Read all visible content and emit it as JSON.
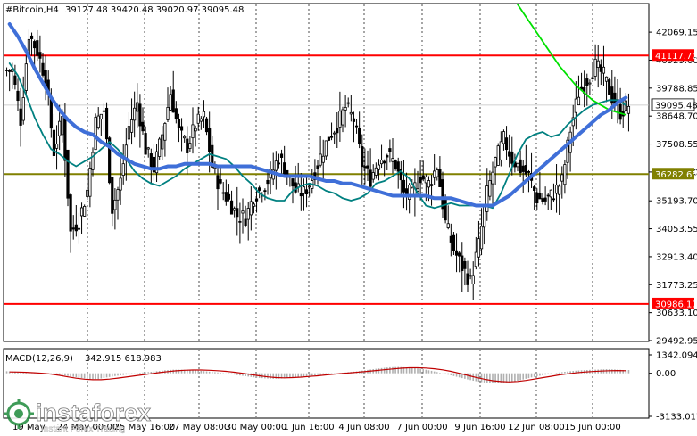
{
  "header": {
    "symbol_text": "#Bitcoin,H4",
    "ohlc_text": "39127.48 39420.48 39020.97 39095.48"
  },
  "macd_header": {
    "label": "MACD(12,26,9)",
    "values": "342.915 618.983"
  },
  "watermark": {
    "brand": "instaforex",
    "tagline": "Instant Forex Trading"
  },
  "colors": {
    "bull_candle": "#000000",
    "bear_candle": "#000000",
    "ma_fast": "#008080",
    "ma_mid": "#00e000",
    "ma_slow": "#3f6fd8",
    "resistance_line": "#ff0000",
    "support_line": "#ff0000",
    "pivot_line": "#808000",
    "macd_signal": "#c00000",
    "macd_hist": "#b0b0b0"
  },
  "chart_data": [
    {
      "type": "candlestick",
      "title": "#Bitcoin,H4",
      "timeframe": "H4",
      "last_ohlc": {
        "open": 39127.48,
        "high": 39420.48,
        "low": 39020.97,
        "close": 39095.48
      },
      "ylim": [
        29492.95,
        43200
      ],
      "y_ticks": [
        "42069.15",
        "40929.00",
        "39788.85",
        "38648.70",
        "37508.55",
        "36368.40",
        "35193.70",
        "34053.55",
        "32913.40",
        "31773.25",
        "30633.10",
        "29492.95"
      ],
      "x_ticks": [
        "19 May",
        "24 May 00:00",
        "25 May 16:00",
        "27 May 08:00",
        "30 May 00:00",
        "1 Jun 16:00",
        "4 Jun 08:00",
        "7 Jun 00:00",
        "9 Jun 16:00",
        "12 Jun 08:00",
        "15 Jun 00:00"
      ],
      "horizontal_levels": [
        {
          "label": "41117.70",
          "value": 41117.7,
          "color": "#ff0000"
        },
        {
          "label": "36282.65",
          "value": 36282.65,
          "color": "#808000"
        },
        {
          "label": "30986.17",
          "value": 30986.17,
          "color": "#ff0000"
        }
      ],
      "current_price_label": "39095.48",
      "close_series": [
        40500,
        38500,
        42000,
        41300,
        40200,
        37200,
        38600,
        33900,
        34400,
        35600,
        38400,
        38900,
        34900,
        36000,
        38200,
        39200,
        37300,
        36500,
        37900,
        39600,
        38000,
        37400,
        38300,
        38600,
        36600,
        35700,
        35200,
        34600,
        34500,
        35400,
        35700,
        36200,
        37000,
        36300,
        35600,
        35500,
        36100,
        37000,
        37800,
        38300,
        39000,
        38500,
        36700,
        36100,
        36900,
        37100,
        36700,
        35500,
        35500,
        36200,
        35900,
        36600,
        34300,
        33200,
        32500,
        31900,
        33400,
        35500,
        36800,
        37700,
        36900,
        36500,
        36200,
        35300,
        35200,
        35500,
        36000,
        38100,
        39600,
        40100,
        40700,
        40300,
        39400,
        38800,
        39100
      ],
      "series": [
        {
          "name": "",
          "color": "#008080",
          "values": [
            40800,
            40300,
            39500,
            38600,
            37900,
            37300,
            37100,
            36800,
            36600,
            36800,
            37000,
            37300,
            37600,
            37300,
            36900,
            36400,
            36100,
            35900,
            35800,
            36000,
            36200,
            36500,
            36700,
            36900,
            37100,
            37000,
            36900,
            36600,
            36200,
            35900,
            35500,
            35300,
            35200,
            35200,
            35600,
            35800,
            35900,
            35800,
            35600,
            35500,
            35300,
            35200,
            35300,
            35500,
            35900,
            36000,
            36200,
            36400,
            36100,
            35500,
            35000,
            34900,
            35000,
            35100,
            35000,
            35000,
            35000,
            35000,
            34900,
            35500,
            36300,
            37100,
            37700,
            37900,
            38000,
            37800,
            37900,
            38300,
            38600,
            38900,
            39100,
            39200,
            39300,
            39300,
            39100
          ]
        },
        {
          "name": "",
          "color": "#00e000",
          "values": [
            null,
            null,
            null,
            null,
            null,
            null,
            null,
            null,
            null,
            null,
            null,
            null,
            null,
            null,
            null,
            null,
            null,
            null,
            null,
            null,
            null,
            null,
            null,
            null,
            null,
            null,
            null,
            null,
            null,
            null,
            null,
            null,
            null,
            null,
            null,
            null,
            null,
            null,
            null,
            null,
            null,
            null,
            null,
            null,
            null,
            null,
            null,
            null,
            null,
            null,
            null,
            null,
            null,
            null,
            null,
            null,
            null,
            null,
            null,
            null,
            null,
            43200,
            42700,
            42200,
            41700,
            41200,
            40700,
            40300,
            39900,
            39600,
            39300,
            39100,
            38900,
            38800,
            38700
          ]
        },
        {
          "name": "",
          "color": "#3f6fd8",
          "values": [
            42400,
            41900,
            41300,
            40600,
            40000,
            39400,
            38900,
            38500,
            38200,
            38000,
            37900,
            37600,
            37400,
            37100,
            36900,
            36700,
            36600,
            36500,
            36500,
            36600,
            36600,
            36700,
            36700,
            36700,
            36700,
            36600,
            36600,
            36600,
            36600,
            36600,
            36500,
            36400,
            36300,
            36200,
            36200,
            36200,
            36200,
            36100,
            36000,
            36000,
            35900,
            35900,
            35800,
            35700,
            35600,
            35500,
            35400,
            35400,
            35400,
            35400,
            35400,
            35300,
            35300,
            35300,
            35200,
            35100,
            35000,
            35000,
            35000,
            35200,
            35400,
            35700,
            36000,
            36300,
            36600,
            36900,
            37200,
            37500,
            37800,
            38100,
            38400,
            38700,
            38900,
            39200,
            39400
          ]
        }
      ]
    },
    {
      "type": "bar",
      "title": "MACD(12,26,9) 342.915 618.983",
      "ylim": [
        -3133.017,
        1342.094
      ],
      "y_ticks": [
        "1342.094",
        "0.00",
        "-3133.017"
      ],
      "macd_histogram": [
        150,
        120,
        80,
        60,
        20,
        -20,
        -80,
        -160,
        -260,
        -350,
        -420,
        -420,
        -300,
        -200,
        -120,
        -40,
        40,
        90,
        150,
        220,
        260,
        260,
        240,
        200,
        140,
        80,
        20,
        -60,
        -160,
        -240,
        -320,
        -370,
        -400,
        -380,
        -330,
        -270,
        -210,
        -150,
        -90,
        -40,
        20,
        80,
        140,
        220,
        300,
        380,
        440,
        460,
        430,
        380,
        300,
        180,
        40,
        -100,
        -250,
        -400,
        -540,
        -640,
        -700,
        -720,
        -680,
        -580,
        -450,
        -300,
        -180,
        -60,
        30,
        110,
        170,
        220,
        250,
        270,
        300,
        280,
        240
      ],
      "signal_line": [
        100,
        90,
        70,
        40,
        0,
        -60,
        -150,
        -260,
        -360,
        -430,
        -470,
        -470,
        -420,
        -350,
        -270,
        -190,
        -110,
        -30,
        50,
        120,
        180,
        220,
        240,
        240,
        220,
        190,
        140,
        80,
        0,
        -90,
        -180,
        -260,
        -310,
        -330,
        -310,
        -280,
        -230,
        -180,
        -120,
        -60,
        -10,
        40,
        90,
        140,
        200,
        260,
        320,
        370,
        400,
        400,
        380,
        330,
        250,
        140,
        0,
        -150,
        -300,
        -430,
        -540,
        -600,
        -620,
        -590,
        -520,
        -420,
        -320,
        -220,
        -120,
        -40,
        30,
        90,
        130,
        160,
        190,
        200,
        190
      ]
    }
  ]
}
